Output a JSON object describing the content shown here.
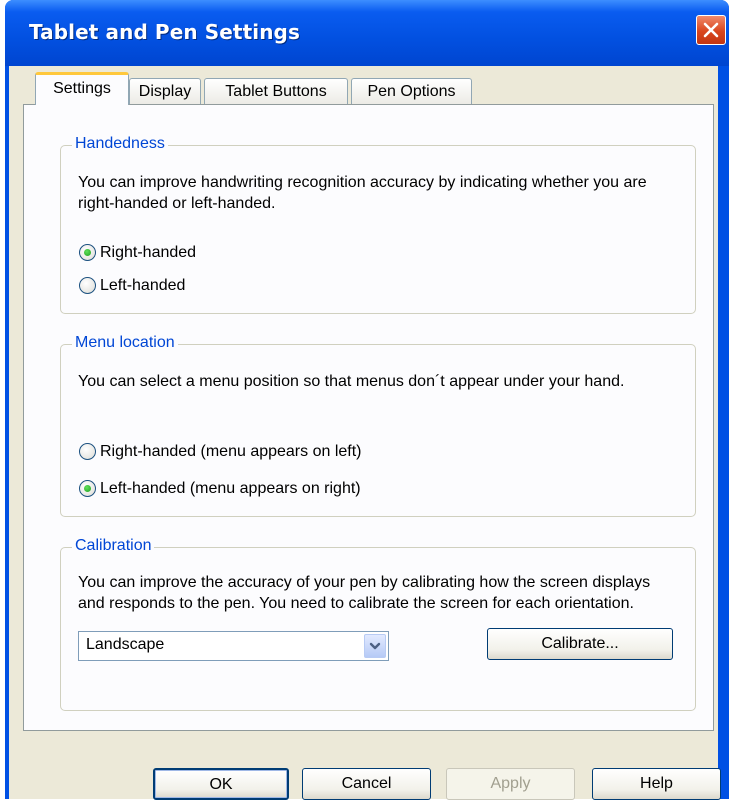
{
  "window": {
    "title": "Tablet and Pen Settings"
  },
  "tabs": [
    {
      "label": "Settings"
    },
    {
      "label": "Display"
    },
    {
      "label": "Tablet Buttons"
    },
    {
      "label": "Pen Options"
    }
  ],
  "handedness": {
    "legend": "Handedness",
    "description": "You can improve handwriting recognition accuracy by indicating whether you are right-handed or left-handed.",
    "options": [
      {
        "label": "Right-handed",
        "selected": true
      },
      {
        "label": "Left-handed",
        "selected": false
      }
    ]
  },
  "menu_location": {
    "legend": "Menu location",
    "description": "You can select a menu position so that menus don´t appear under your hand.",
    "options": [
      {
        "label": "Right-handed (menu appears on left)",
        "selected": false
      },
      {
        "label": "Left-handed (menu appears on right)",
        "selected": true
      }
    ]
  },
  "calibration": {
    "legend": "Calibration",
    "description": "You can improve the accuracy of your pen by calibrating how the screen displays and responds to the pen. You need to calibrate the screen for each orientation.",
    "orientation_value": "Landscape",
    "calibrate_label": "Calibrate..."
  },
  "footer": {
    "ok_label": "OK",
    "cancel_label": "Cancel",
    "apply_label": "Apply",
    "help_label": "Help"
  }
}
